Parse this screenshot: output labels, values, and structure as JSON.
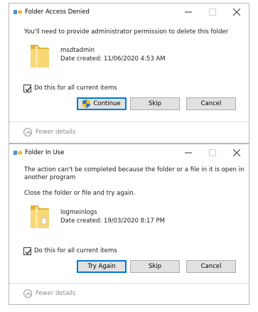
{
  "dialogs": [
    {
      "title": "Folder Access Denied",
      "message_lines": [
        "You'll need to provide administrator permission to delete this folder"
      ],
      "folder_name": "msdtadmin",
      "date_created": "Date created: 11/06/2020 4:53 AM",
      "checkbox_label": "Do this for all current items",
      "checkbox_checked": true,
      "buttons": {
        "primary": "Continue",
        "skip": "Skip",
        "cancel": "Cancel"
      },
      "fewer_details": "Fewer details"
    },
    {
      "title": "Folder In Use",
      "message_lines": [
        "The action can't be completed because the folder or a file in it is open in",
        "another program"
      ],
      "instruction": "Close the folder or file and try again.",
      "folder_name": "logmeinlogs",
      "date_created": "Date created: 19/03/2020 8:17 PM",
      "checkbox_label": "Do this for all current items",
      "checkbox_checked": true,
      "buttons": {
        "primary": "Try Again",
        "skip": "Skip",
        "cancel": "Cancel"
      },
      "fewer_details": "Fewer details"
    }
  ],
  "icons": {
    "app": "file-move-icon",
    "folder": "folder-icon",
    "shield": "uac-shield-icon",
    "details": "chevron-up-circle-icon"
  },
  "colors": {
    "folder": "#f8d775",
    "folder_dark": "#e0b243",
    "accent": "#0078d7",
    "button_bg": "#e1e1e1",
    "muted_text": "#8a8a8a"
  }
}
